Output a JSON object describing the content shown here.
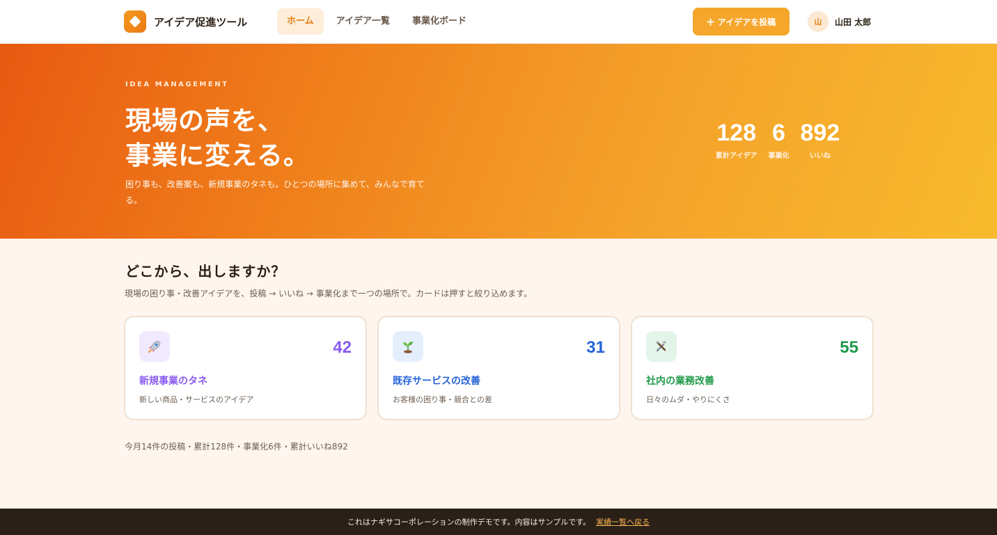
{
  "app": {
    "name": "アイデア促進ツール",
    "logo_icon": "diamond-icon"
  },
  "nav": {
    "items": [
      {
        "label": "ホーム",
        "active": true
      },
      {
        "label": "アイデア一覧",
        "active": false
      },
      {
        "label": "事業化ボード",
        "active": false
      }
    ]
  },
  "header": {
    "post_button": {
      "icon": "plus-icon",
      "label": "アイデアを投稿"
    },
    "user": {
      "avatar_text": "山",
      "name": "山田 太郎"
    }
  },
  "hero": {
    "eyebrow": "IDEA MANAGEMENT",
    "title_line1": "現場の声を、",
    "title_line2": "事業に変える。",
    "subtitle": "困り事も、改善案も、新規事業のタネも。ひとつの場所に集めて、みんなで育てる。",
    "stats": [
      {
        "value": "128",
        "label": "累計アイデア"
      },
      {
        "value": "6",
        "label": "事業化"
      },
      {
        "value": "892",
        "label": "いいね"
      }
    ]
  },
  "main": {
    "title": "どこから、出しますか？",
    "subtitle": "現場の困り事・改善アイデアを、投稿 → いいね → 事業化まで一つの場所で。カードは押すと絞り込めます。",
    "cards": [
      {
        "icon": "rocket-icon",
        "count": "42",
        "title": "新規事業のタネ",
        "desc": "新しい商品・サービスのアイデア",
        "accent": "#8a5cf0",
        "icon_bg": "#f1e9fd"
      },
      {
        "icon": "sprout-icon",
        "count": "31",
        "title": "既存サービスの改善",
        "desc": "お客様の困り事・競合との差",
        "accent": "#2563d8",
        "icon_bg": "#e5eefc"
      },
      {
        "icon": "tools-icon",
        "count": "55",
        "title": "社内の業務改善",
        "desc": "日々のムダ・やりにくさ",
        "accent": "#1f9a4a",
        "icon_bg": "#e3f5e8"
      }
    ],
    "summary": "今月14件の投稿・累計128件・事業化6件・累計いいね892"
  },
  "footer": {
    "text": "これはナギサコーポレーションの制作デモです。内容はサンプルです。",
    "link": "実績一覧へ戻る"
  },
  "colors": {
    "brand": "#f5a62b",
    "nav_active_bg": "#fdedd9",
    "nav_active_text": "#e77d12",
    "hero_gradient_start": "#e85a12",
    "hero_gradient_end": "#f8bb2d",
    "footer_bg": "#2a2018"
  }
}
